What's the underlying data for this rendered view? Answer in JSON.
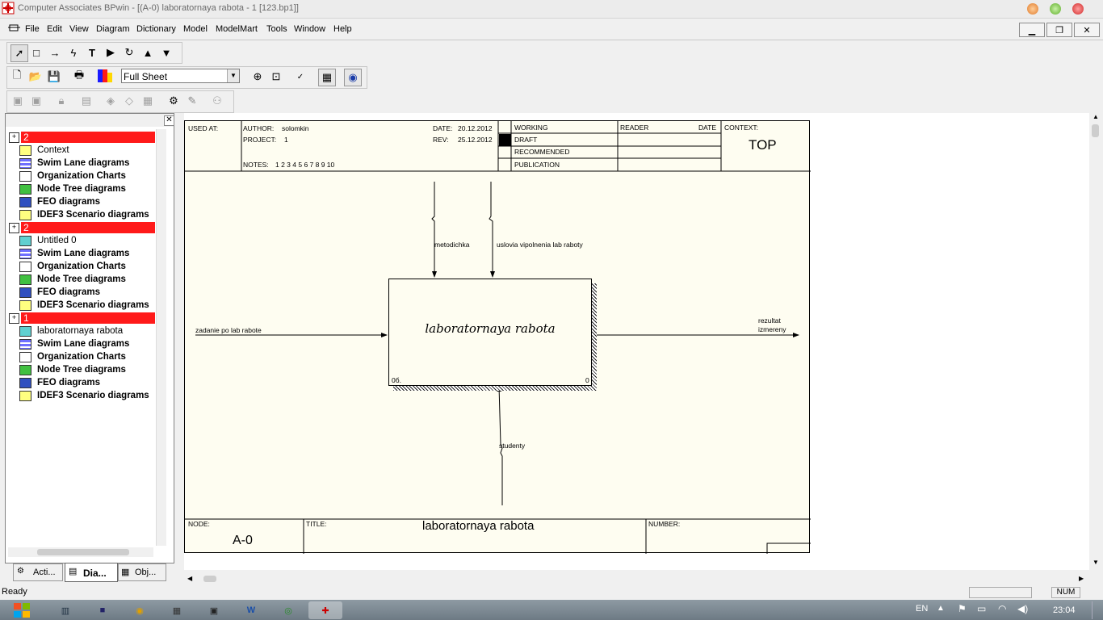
{
  "window": {
    "title": "Computer Associates BPwin - [(A-0) laboratornaya rabota - 1  [123.bp1]]"
  },
  "menu": [
    "File",
    "Edit",
    "View",
    "Diagram",
    "Dictionary",
    "Model",
    "ModelMart",
    "Tools",
    "Window",
    "Help"
  ],
  "toolbar": {
    "zoom_select_value": "Full Sheet"
  },
  "tree": {
    "groups": [
      {
        "badge": "2",
        "name": "Context",
        "items": [
          "Swim Lane diagrams",
          "Organization Charts",
          "Node Tree diagrams",
          "FEO diagrams",
          "IDEF3 Scenario diagrams"
        ]
      },
      {
        "badge": "2",
        "name": "Untitled 0",
        "items": [
          "Swim Lane diagrams",
          "Organization Charts",
          "Node Tree diagrams",
          "FEO diagrams",
          "IDEF3 Scenario diagrams"
        ]
      },
      {
        "badge": "1",
        "name": "laboratornaya rabota",
        "items": [
          "Swim Lane diagrams",
          "Organization Charts",
          "Node Tree diagrams",
          "FEO diagrams",
          "IDEF3 Scenario diagrams"
        ]
      }
    ],
    "tabs": [
      "Acti...",
      "Dia...",
      "Obj..."
    ]
  },
  "frame": {
    "used_at": "USED AT:",
    "author_label": "AUTHOR:",
    "author": "solomkin",
    "project_label": "PROJECT:",
    "project": "1",
    "date_label": "DATE:",
    "date": "20.12.2012",
    "rev_label": "REV:",
    "rev": "25.12.2012",
    "notes_label": "NOTES:",
    "notes": "1  2  3  4  5  6  7  8  9  10",
    "status": [
      "WORKING",
      "DRAFT",
      "RECOMMENDED",
      "PUBLICATION"
    ],
    "reader": "READER",
    "date_col": "DATE",
    "context_label": "CONTEXT:",
    "context": "TOP",
    "node_label": "NODE:",
    "node": "A-0",
    "title_label": "TITLE:",
    "title": "laboratornaya rabota",
    "number_label": "NUMBER:"
  },
  "diagram": {
    "activity": "laboratornaya rabota",
    "box_cost": "0б.",
    "box_number": "0",
    "control_1": "metodichka",
    "control_2": "uslovia vipolnenia lab raboty",
    "input": "zadanie po lab rabote",
    "output_line1": "rezultat",
    "output_line2": "izmereny",
    "mechanism": "studenty"
  },
  "status_bar": {
    "text": "Ready",
    "num": "NUM"
  },
  "tray": {
    "lang": "EN",
    "time": "23:04"
  }
}
